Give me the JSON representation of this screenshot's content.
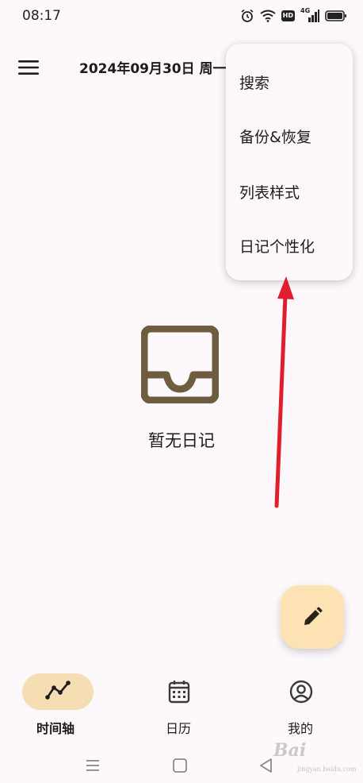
{
  "status_bar": {
    "time": "08:17",
    "hd_label": "HD",
    "network_label": "4G"
  },
  "top_bar": {
    "date_title": "2024年09月30日 周一",
    "menu_icon": "hamburger-menu-icon"
  },
  "popup_menu": {
    "items": [
      "搜索",
      "备份&恢复",
      "列表样式",
      "日记个性化"
    ]
  },
  "empty_state": {
    "icon": "inbox-tray-icon",
    "text": "暂无日记"
  },
  "fab": {
    "icon": "pencil-icon"
  },
  "bottom_nav": {
    "items": [
      {
        "label": "时间轴",
        "icon": "timeline-icon",
        "active": true
      },
      {
        "label": "日历",
        "icon": "calendar-icon",
        "active": false
      },
      {
        "label": "我的",
        "icon": "profile-icon",
        "active": false
      }
    ]
  },
  "system_nav": {
    "icons": [
      "recents-icon",
      "home-icon",
      "back-icon"
    ]
  },
  "watermark": {
    "text": "Bai",
    "sub": "jingyan.baidu.com"
  },
  "colors": {
    "background": "#fdf8fb",
    "fab": "#fde3b3",
    "nav_pill": "#f5ddb4",
    "empty_icon": "#6e5e3f",
    "arrow": "#e01e2e"
  }
}
